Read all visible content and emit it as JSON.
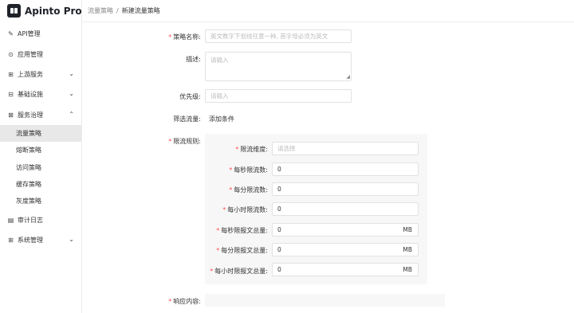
{
  "app": {
    "name": "Apinto Pro"
  },
  "sidebar": {
    "items": [
      {
        "label": "API管理",
        "icon": "api-icon"
      },
      {
        "label": "应用管理",
        "icon": "app-icon"
      },
      {
        "label": "上游服务",
        "icon": "upstream-icon",
        "expandable": true
      },
      {
        "label": "基础设施",
        "icon": "infrastructure-icon",
        "expandable": true
      },
      {
        "label": "服务治理",
        "icon": "governance-icon",
        "expandable": true,
        "expanded": true
      },
      {
        "label": "审计日志",
        "icon": "audit-log-icon"
      },
      {
        "label": "系统管理",
        "icon": "system-icon",
        "expandable": true
      }
    ],
    "sub_items": [
      {
        "label": "流量策略",
        "active": true
      },
      {
        "label": "熔断策略"
      },
      {
        "label": "访问策略"
      },
      {
        "label": "缓存策略"
      },
      {
        "label": "灰度策略"
      }
    ]
  },
  "breadcrumb": {
    "parent": "流量策略",
    "separator": "/",
    "current": "新建流量策略"
  },
  "form": {
    "name": {
      "label": "策略名称:",
      "placeholder": "英文数字下划线任意一种, 首字母必须为英文"
    },
    "description": {
      "label": "描述:",
      "placeholder": "请输入"
    },
    "priority": {
      "label": "优先级:",
      "placeholder": "请输入"
    },
    "filter": {
      "label": "筛选流量:",
      "button": "添加条件"
    },
    "rules": {
      "label": "限流规则:",
      "dimension": {
        "label": "限流维度:",
        "placeholder": "请选择"
      },
      "per_second_count": {
        "label": "每秒限流数:",
        "value": "0"
      },
      "per_minute_count": {
        "label": "每分限流数:",
        "value": "0"
      },
      "per_hour_count": {
        "label": "每小时限流数:",
        "value": "0"
      },
      "per_second_size": {
        "label": "每秒限报文总量:",
        "value": "0",
        "unit": "MB"
      },
      "per_minute_size": {
        "label": "每分限报文总量:",
        "value": "0",
        "unit": "MB"
      },
      "per_hour_size": {
        "label": "每小时限报文总量:",
        "value": "0",
        "unit": "MB"
      }
    },
    "response": {
      "label": "响应内容:"
    }
  }
}
